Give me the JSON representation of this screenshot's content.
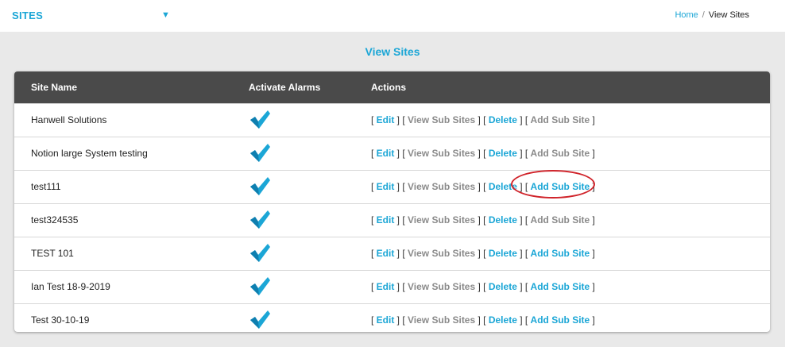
{
  "header": {
    "title": "SITES",
    "dropdown_icon": "triangle-down-icon",
    "breadcrumb": {
      "home": "Home",
      "separator": "/",
      "current": "View Sites"
    }
  },
  "page": {
    "title": "View Sites"
  },
  "table": {
    "columns": [
      "Site Name",
      "Activate Alarms",
      "Actions"
    ],
    "action_labels": {
      "edit": "Edit",
      "view_sub_sites": "View Sub Sites",
      "delete": "Delete",
      "add_sub_site": "Add Sub Site"
    },
    "rows": [
      {
        "name": "Hanwell Solutions",
        "alarms_active": true,
        "add_sub_site_enabled": false
      },
      {
        "name": "Notion large System testing",
        "alarms_active": true,
        "add_sub_site_enabled": false
      },
      {
        "name": "test111",
        "alarms_active": true,
        "add_sub_site_enabled": true
      },
      {
        "name": "test324535",
        "alarms_active": true,
        "add_sub_site_enabled": false
      },
      {
        "name": "TEST 101",
        "alarms_active": true,
        "add_sub_site_enabled": true
      },
      {
        "name": "Ian Test 18-9-2019",
        "alarms_active": true,
        "add_sub_site_enabled": true
      },
      {
        "name": "Test 30-10-19",
        "alarms_active": true,
        "add_sub_site_enabled": true
      }
    ]
  },
  "colors": {
    "accent": "#1ba6d6",
    "header_bg": "#4a4a4a",
    "disabled_link": "#8a8a8a",
    "annotation": "#d0232a"
  }
}
